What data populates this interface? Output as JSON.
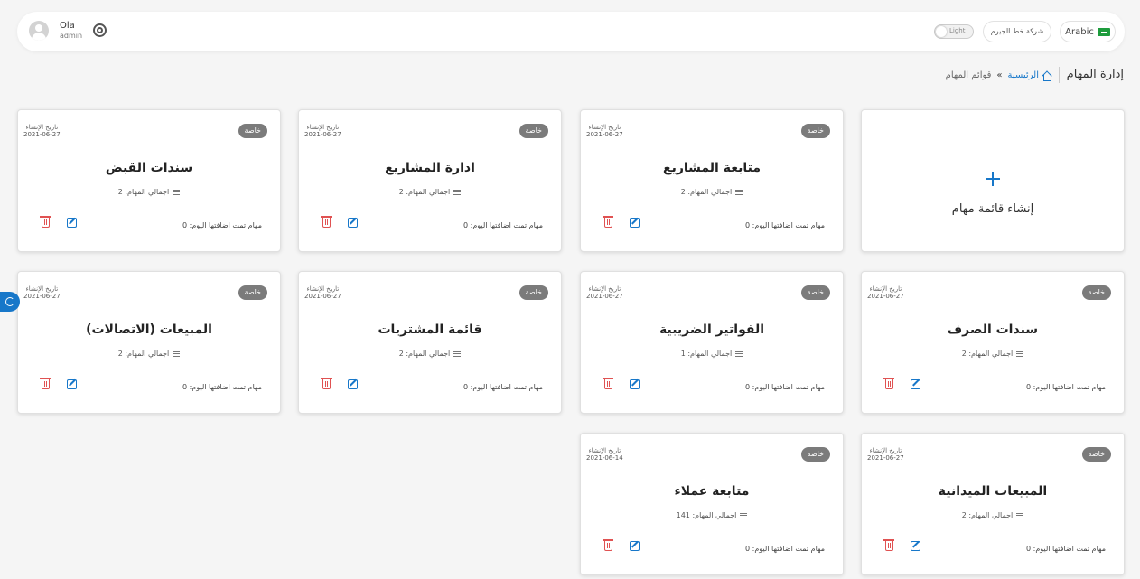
{
  "header": {
    "user_name": "Ola",
    "user_role": "admin",
    "theme_toggle_label": "Light",
    "company_label": "شركة خط الجيرم",
    "language_label": "Arabic"
  },
  "page": {
    "title": "إدارة المهام",
    "breadcrumb_home": "الرئيسية",
    "breadcrumb_separator": "»",
    "breadcrumb_current": "قوائم المهام"
  },
  "new_card": {
    "label": "إنشاء قائمة مهام"
  },
  "card_labels": {
    "badge": "خاصة",
    "date_label": "تاريخ الإنشاء",
    "total_prefix": "اجمالي المهام:",
    "today_prefix": "مهام تمت اضافتها اليوم:"
  },
  "cards": [
    {
      "title": "متابعة المشاريع",
      "date": "2021-06-27",
      "total": "2",
      "today": "0"
    },
    {
      "title": "ادارة المشاريع",
      "date": "2021-06-27",
      "total": "2",
      "today": "0"
    },
    {
      "title": "سندات القبض",
      "date": "2021-06-27",
      "total": "2",
      "today": "0"
    },
    {
      "title": "سندات الصرف",
      "date": "2021-06-27",
      "total": "2",
      "today": "0"
    },
    {
      "title": "الفواتير الضريبية",
      "date": "2021-06-27",
      "total": "1",
      "today": "0"
    },
    {
      "title": "قائمة المشتريات",
      "date": "2021-06-27",
      "total": "2",
      "today": "0"
    },
    {
      "title": "المبيعات (الاتصالات)",
      "date": "2021-06-27",
      "total": "2",
      "today": "0"
    },
    {
      "title": "المبيعات الميدانية",
      "date": "2021-06-27",
      "total": "2",
      "today": "0"
    },
    {
      "title": "متابعة عملاء",
      "date": "2021-06-14",
      "total": "141",
      "today": "0"
    }
  ],
  "colors": {
    "accent": "#1777c9",
    "danger": "#e05252",
    "badge": "#7b7b7b"
  }
}
